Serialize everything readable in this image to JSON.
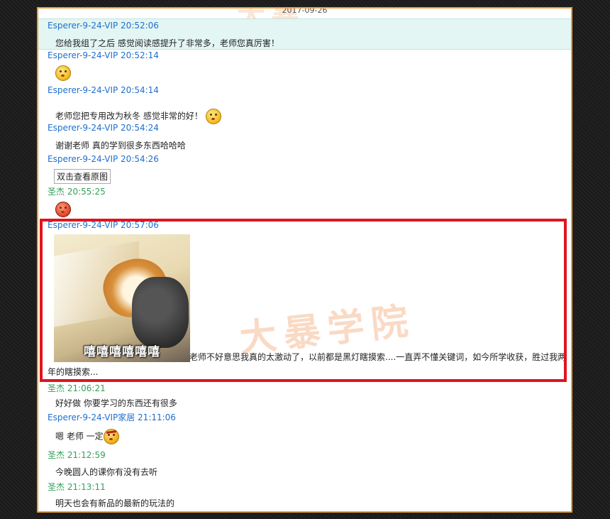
{
  "date": "2017-09-26",
  "watermark": "大暴学院",
  "watermark_top": "大暴",
  "messages": [
    {
      "sender": "Esperer-9-24-VIP 20:52:06",
      "text": "您给我组了之后 感觉阅读感提升了非常多，老师您真厉害！"
    },
    {
      "sender": "Esperer-9-24-VIP 20:52:14",
      "emoji": "kiss-emoji-icon"
    },
    {
      "sender": "Esperer-9-24-VIP 20:54:14",
      "text": "老师您把专用改为秋冬 感觉非常的好！"
    },
    {
      "sender": "Esperer-9-24-VIP 20:54:24",
      "text": "谢谢老师 真的学到很多东西哈哈哈"
    },
    {
      "sender": "Esperer-9-24-VIP 20:54:26",
      "button": "双击查看原图"
    },
    {
      "sender": "圣杰 20:55:25",
      "emoji": "blush-emoji-icon"
    },
    {
      "sender": "Esperer-9-24-VIP 20:57:06",
      "image_caption": "嘻嘻嘻嘻嘻嘻",
      "text": "老师不好意思我真的太激动了，以前都是黑灯瞎摸索....一直弄不懂关键词，如今所学收获，胜过我两年的瞎摸索..."
    },
    {
      "sender": "圣杰 21:06:21",
      "text": "好好做 你要学习的东西还有很多"
    },
    {
      "sender": "Esperer-9-24-VIP家居 21:11:06",
      "text": "嗯 老师 一定"
    },
    {
      "sender": "圣杰 21:12:59",
      "text": "今晚圆人的课你有没有去听"
    },
    {
      "sender": "圣杰 21:13:11",
      "text": "明天也会有新品的最新的玩法的"
    }
  ],
  "colors": {
    "accent_border": "#f0a030",
    "highlight_box": "#e0141e",
    "sender_blue": "#1e6fcf",
    "sender_green": "#33a058"
  }
}
